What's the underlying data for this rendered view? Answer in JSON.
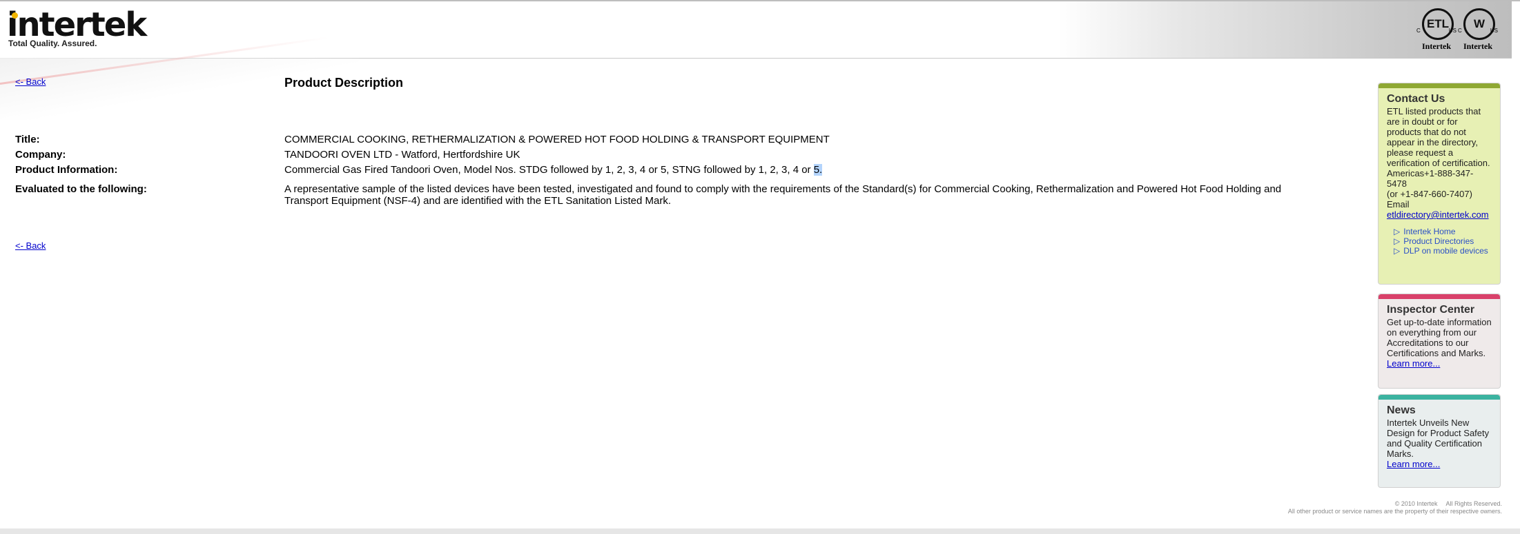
{
  "brand": {
    "logo_text": "intertek",
    "tagline": "Total Quality. Assured.",
    "marks": [
      {
        "label": "Intertek",
        "symbol": "ETL",
        "c": "C",
        "us": "US"
      },
      {
        "label": "Intertek",
        "symbol": "W",
        "c": "C",
        "us": "US"
      }
    ]
  },
  "nav": {
    "back_top": "<- Back",
    "back_bottom": "<- Back"
  },
  "page": {
    "title": "Product Description"
  },
  "details": {
    "title_label": "Title:",
    "title_value": "COMMERCIAL COOKING, RETHERMALIZATION & POWERED HOT FOOD HOLDING & TRANSPORT EQUIPMENT",
    "company_label": "Company:",
    "company_value": "TANDOORI OVEN LTD - Watford, Hertfordshire UK",
    "product_label": "Product Information:",
    "product_value_main": "Commercial Gas Fired Tandoori Oven, Model Nos. STDG followed by 1, 2, 3, 4 or 5, STNG followed by 1, 2, 3, 4 or ",
    "product_value_selected": "5.",
    "evaluated_label": "Evaluated to the following:",
    "evaluated_value": "A representative sample of the listed devices have been tested, investigated and found to comply with the requirements of the Standard(s) for Commercial Cooking, Rethermalization and Powered Hot Food Holding and Transport Equipment (NSF-4) and are identified with the ETL Sanitation Listed Mark."
  },
  "sidebar": {
    "contact": {
      "heading": "Contact Us",
      "body": "ETL listed products that are in doubt or for products that do not appear in the directory, please request a verification of certification.",
      "americas": "Americas+1-888-347-5478",
      "alt_phone": "(or +1-847-660-7407)",
      "email_label": "Email",
      "email": "etldirectory@intertek.com",
      "links": [
        "Intertek Home",
        "Product Directories",
        "DLP on mobile devices"
      ],
      "accent": "#8fa833",
      "bg": "#e7f0b4"
    },
    "inspector": {
      "heading": "Inspector Center",
      "body": "Get up-to-date information on everything from our Accreditations to our Certifications and Marks. ",
      "link": "Learn more...",
      "accent": "#d9416a",
      "bg": "#efeaea"
    },
    "news": {
      "heading": "News",
      "body": "Intertek Unveils New Design for Product Safety and Quality Certification Marks.",
      "link": "Learn more...",
      "accent": "#3bb3a0",
      "bg": "#e9eeee"
    }
  },
  "footer": {
    "copyright": "© 2010 Intertek     All Rights Reserved.",
    "trademark": "All other product or service names are the property of their respective owners."
  }
}
